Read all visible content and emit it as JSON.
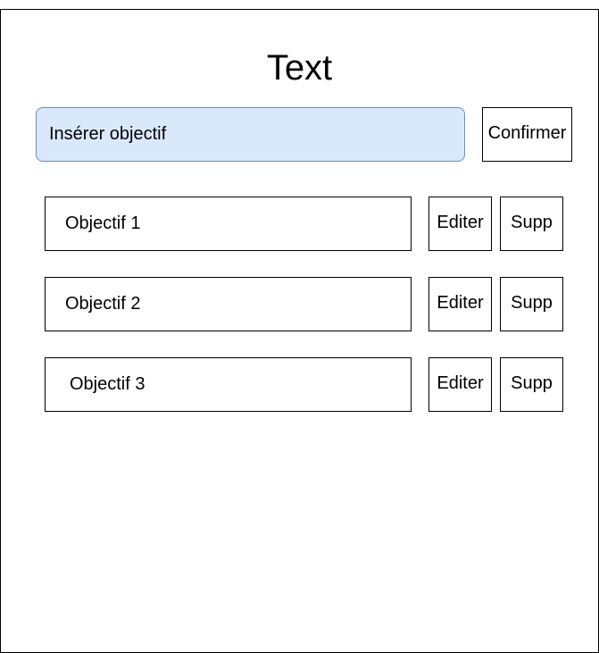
{
  "title": "Text",
  "input": {
    "placeholder": "Insérer objectif",
    "value": ""
  },
  "confirm_label": "Confirmer",
  "objectives": [
    {
      "label": "Objectif 1",
      "edit_label": "Editer",
      "delete_label": "Supp"
    },
    {
      "label": "Objectif 2",
      "edit_label": "Editer",
      "delete_label": "Supp"
    },
    {
      "label": "Objectif 3",
      "edit_label": "Editer",
      "delete_label": "Supp"
    }
  ],
  "colors": {
    "input_background": "#dae8fc",
    "input_border": "#6c8ebf",
    "border": "#000000",
    "background": "#ffffff"
  }
}
